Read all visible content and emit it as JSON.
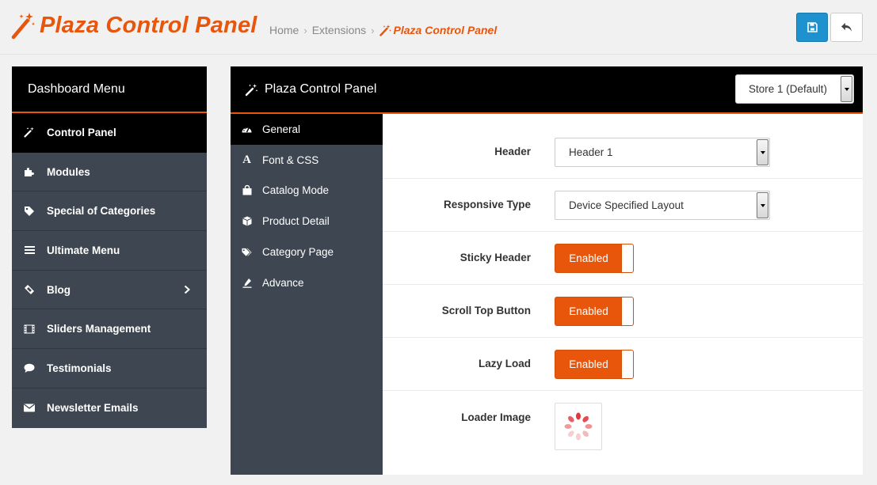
{
  "header": {
    "title": "Plaza Control Panel",
    "breadcrumb": [
      "Home",
      "Extensions"
    ],
    "breadcrumb_active": "Plaza Control Panel",
    "save_icon": "floppy-disk-icon",
    "back_icon": "reply-arrow-icon"
  },
  "dashboard": {
    "title": "Dashboard Menu",
    "items": [
      {
        "label": "Control Panel",
        "icon": "magic-wand-icon",
        "active": true
      },
      {
        "label": "Modules",
        "icon": "puzzle-icon"
      },
      {
        "label": "Special of Categories",
        "icon": "tag-icon"
      },
      {
        "label": "Ultimate Menu",
        "icon": "bars-icon"
      },
      {
        "label": "Blog",
        "icon": "ticket-icon",
        "has_submenu": true
      },
      {
        "label": "Sliders Management",
        "icon": "film-icon"
      },
      {
        "label": "Testimonials",
        "icon": "comment-icon"
      },
      {
        "label": "Newsletter Emails",
        "icon": "envelope-icon"
      }
    ]
  },
  "panel": {
    "title": "Plaza Control Panel",
    "store_select": "Store 1 (Default)",
    "tabs": [
      {
        "label": "General",
        "icon": "dashboard-gauge-icon",
        "active": true
      },
      {
        "label": "Font & CSS",
        "icon": "font-icon"
      },
      {
        "label": "Catalog Mode",
        "icon": "shopping-bag-icon"
      },
      {
        "label": "Product Detail",
        "icon": "cube-icon"
      },
      {
        "label": "Category Page",
        "icon": "tags-icon"
      },
      {
        "label": "Advance",
        "icon": "eyedropper-icon"
      }
    ],
    "fields": {
      "header": {
        "label": "Header",
        "value": "Header 1"
      },
      "responsive": {
        "label": "Responsive Type",
        "value": "Device Specified Layout"
      },
      "sticky": {
        "label": "Sticky Header",
        "value": "Enabled"
      },
      "scrolltop": {
        "label": "Scroll Top Button",
        "value": "Enabled"
      },
      "lazyload": {
        "label": "Lazy Load",
        "value": "Enabled"
      },
      "loader": {
        "label": "Loader Image",
        "icon": "spinner-icon"
      }
    }
  },
  "colors": {
    "accent": "#e8560c",
    "primary_button": "#1e91cf",
    "sidebar_bg": "#3e4751",
    "active_bg": "#000000"
  }
}
